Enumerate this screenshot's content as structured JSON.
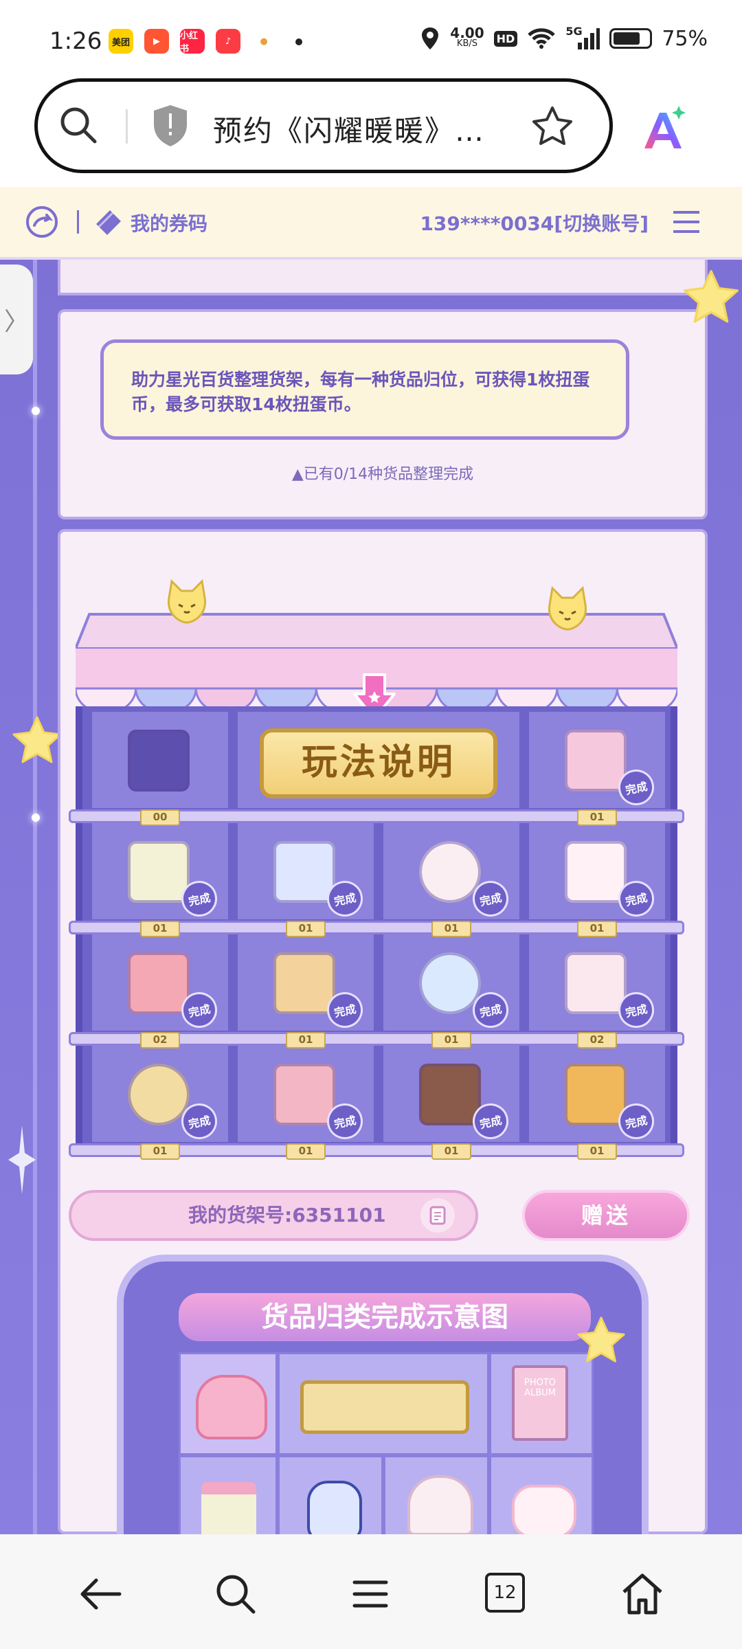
{
  "status_bar": {
    "time": "1:26",
    "apps": [
      {
        "icon": "meituan-icon",
        "label": "美团",
        "color": "#ffd000",
        "text_color": "#222"
      },
      {
        "icon": "video-icon",
        "label": "▶",
        "color": "#ff5533",
        "text_color": "#fff"
      },
      {
        "icon": "xiaohongshu-icon",
        "label": "小红书",
        "color": "#ff2442",
        "text_color": "#fff"
      },
      {
        "icon": "music-icon",
        "label": "♪",
        "color": "#fc3c44",
        "text_color": "#fff"
      },
      {
        "icon": "app-icon",
        "label": "●",
        "color": "#ffffff",
        "text_color": "#e7a23a"
      }
    ],
    "network_speed": "4.00",
    "network_unit": "KB/S",
    "hd": "HD",
    "signal": "5G",
    "battery": "75%",
    "battery_level": 0.75
  },
  "browser": {
    "title": "预约《闪耀暖暖》…"
  },
  "header": {
    "coupon_label": "我的券码",
    "account": "139****0034[切换账号]"
  },
  "notice": {
    "text": "助力星光百货整理货架，每有一种货品归位，可获得1枚扭蛋币，最多可获取14枚扭蛋币。",
    "progress": "▲已有0/14种货品整理完成"
  },
  "shelf": {
    "howto_label": "玩法说明",
    "done_label": "完成",
    "row1": [
      {
        "name": "backpack",
        "tag": "00",
        "done": false
      },
      {
        "name": "photo-album",
        "tag": "01",
        "done": true
      }
    ],
    "row2": [
      {
        "name": "flower-basket",
        "tag": "01",
        "done": true
      },
      {
        "name": "perfume-bottle",
        "tag": "01",
        "done": true
      },
      {
        "name": "seashell",
        "tag": "01",
        "done": true
      },
      {
        "name": "bunny-mug",
        "tag": "01",
        "done": true
      }
    ],
    "row3": [
      {
        "name": "pink-cap",
        "tag": "02",
        "done": true
      },
      {
        "name": "suitcase",
        "tag": "01",
        "done": true
      },
      {
        "name": "crystal-ball",
        "tag": "01",
        "done": true
      },
      {
        "name": "milk-carton",
        "tag": "02",
        "done": true
      }
    ],
    "row4": [
      {
        "name": "moon-pillow",
        "tag": "01",
        "done": true
      },
      {
        "name": "nikki-palette",
        "tag": "01",
        "done": true
      },
      {
        "name": "cake-slice",
        "tag": "01",
        "done": true
      },
      {
        "name": "camera",
        "tag": "01",
        "done": true
      }
    ]
  },
  "actions": {
    "shelf_number": "我的货架号:6351101",
    "gift_label": "赠送"
  },
  "demo": {
    "title": "货品归类完成示意图",
    "photo_album_label": "PHOTO ALBUM"
  },
  "nav": {
    "tabs_count": "12"
  }
}
